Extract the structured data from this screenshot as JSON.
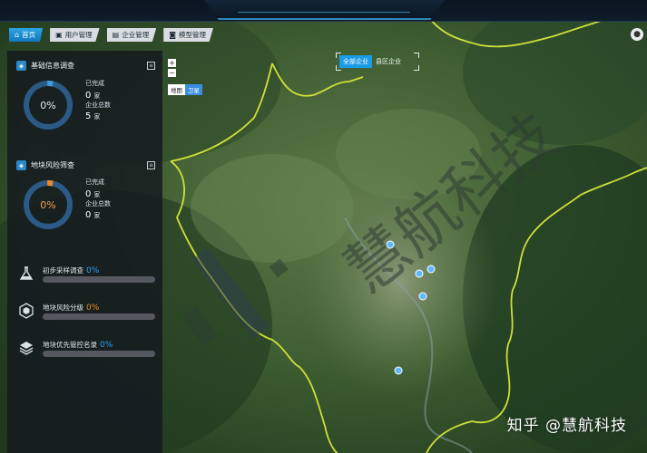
{
  "nav": {
    "tabs": [
      {
        "label": "首页",
        "icon": "home-icon",
        "active": true
      },
      {
        "label": "用户管理",
        "icon": "user-icon",
        "active": false
      },
      {
        "label": "企业管理",
        "icon": "building-icon",
        "active": false
      },
      {
        "label": "模型管理",
        "icon": "model-icon",
        "active": false
      }
    ]
  },
  "panel": {
    "basic": {
      "title": "基础信息调查",
      "percent_label": "0%",
      "completed_label": "已完成",
      "completed_value": "0",
      "total_label": "企业总数",
      "total_value": "5",
      "unit": "家",
      "progress": 0
    },
    "risk": {
      "title": "地块风险筛查",
      "percent_label": "0%",
      "completed_label": "已完成",
      "completed_value": "0",
      "total_label": "企业总数",
      "total_value": "0",
      "unit": "家",
      "progress": 0
    },
    "bars": [
      {
        "label": "初步采样调查",
        "percent": "0%",
        "color": "#29a3ff",
        "icon": "flask-icon",
        "progress": 0
      },
      {
        "label": "地块风险分级",
        "percent": "0%",
        "color": "#f08a24",
        "icon": "hexagon-icon",
        "progress": 0
      },
      {
        "label": "地块优先管控名录",
        "percent": "0%",
        "color": "#29a3ff",
        "icon": "layers-icon",
        "progress": 0
      }
    ]
  },
  "map": {
    "zoom_in": "+",
    "zoom_out": "−",
    "type_map": "地图",
    "type_satellite": "卫星",
    "filter_all": "全部企业",
    "filter_county": "县区企业",
    "watermark_text": "慧航科技",
    "credit": "知乎 @慧航科技"
  },
  "colors": {
    "accent": "#1c9be6",
    "ring_blue": "#2b89c8",
    "ring_orange": "#f08a24",
    "boundary": "#d8e83a"
  }
}
